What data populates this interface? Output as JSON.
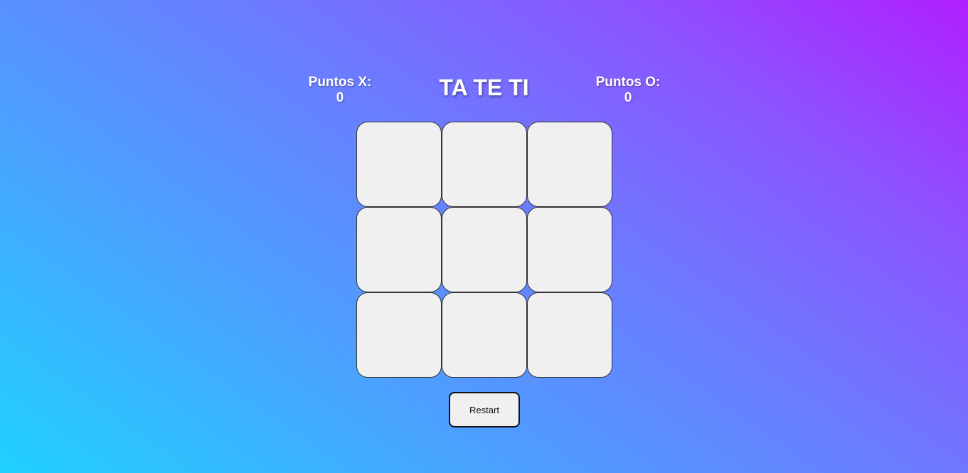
{
  "title": "TA TE TI",
  "score_x": {
    "label": "Puntos X:",
    "value": "0"
  },
  "score_o": {
    "label": "Puntos O:",
    "value": "0"
  },
  "board": {
    "cells": [
      "",
      "",
      "",
      "",
      "",
      "",
      "",
      "",
      ""
    ]
  },
  "restart_label": "Restart",
  "colors": {
    "gradient_start": "#1fd1ff",
    "gradient_end": "#b01fff",
    "cell_background": "#f0f0f0"
  }
}
